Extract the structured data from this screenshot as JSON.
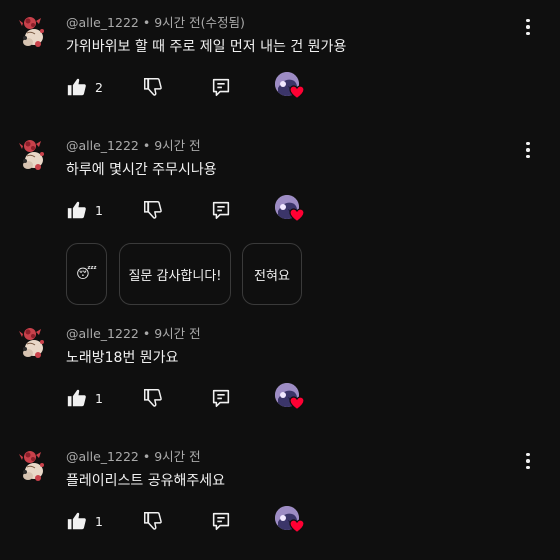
{
  "comments": [
    {
      "author": "@alle_1222",
      "time": "9시간 전(수정됨)",
      "text": "가위바위보 할 때 주로 제일 먼저 내는 건 뭔가용",
      "likes": "2"
    },
    {
      "author": "@alle_1222",
      "time": "9시간 전",
      "text": "하루에 몇시간 주무시나용",
      "likes": "1"
    },
    {
      "author": "@alle_1222",
      "time": "9시간 전",
      "text": "노래방18번 뭔가요",
      "likes": "1"
    },
    {
      "author": "@alle_1222",
      "time": "9시간 전",
      "text": "플레이리스트 공유해주세요",
      "likes": "1"
    }
  ],
  "separator": "•",
  "reply_suggestions": [
    "😴",
    "질문 감사합니다!",
    "전혀요"
  ],
  "icons": {
    "like": "thumbs-up-icon",
    "dislike": "thumbs-down-icon",
    "reply": "reply-icon",
    "more": "more-vertical-icon",
    "heart": "creator-heart-icon"
  },
  "colors": {
    "background": "#0f0f0f",
    "text": "#f1f1f1",
    "secondary_text": "#aaaaaa",
    "heart": "#ff0033"
  }
}
